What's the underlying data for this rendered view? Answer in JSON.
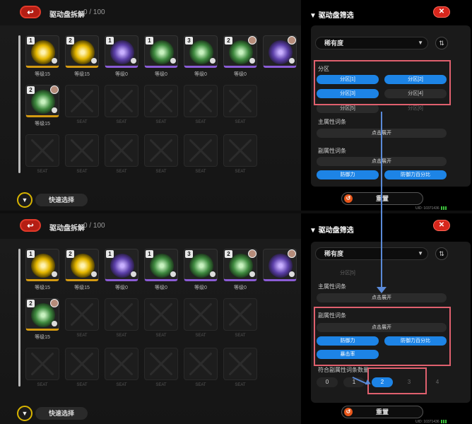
{
  "inventory": {
    "back_label": "↩",
    "title": "驱动盘拆解",
    "count": "0 / 100",
    "quick_select": "快速选择",
    "items": [
      {
        "rank": "1",
        "level": "等级15",
        "disc": "yellow",
        "accent": "gold",
        "avatar": false
      },
      {
        "rank": "2",
        "level": "等级15",
        "disc": "yellow",
        "accent": "gold",
        "avatar": false
      },
      {
        "rank": "1",
        "level": "等级0",
        "disc": "violet",
        "accent": "purple",
        "avatar": false
      },
      {
        "rank": "1",
        "level": "等级0",
        "disc": "green",
        "accent": "purple",
        "avatar": false
      },
      {
        "rank": "3",
        "level": "等级0",
        "disc": "green",
        "accent": "purple",
        "avatar": false
      },
      {
        "rank": "2",
        "level": "等级0",
        "disc": "green",
        "accent": "purple",
        "avatar": true
      },
      {
        "rank": "",
        "level": "",
        "disc": "violet",
        "accent": "purple",
        "avatar": true
      },
      {
        "rank": "2",
        "level": "等级15",
        "disc": "green",
        "accent": "gold",
        "avatar": true
      }
    ],
    "empty_label": "SEAT"
  },
  "filter": {
    "title": "驱动盘筛选",
    "close_label": "✕",
    "sort_select": "稀有度",
    "partition_label": "分区",
    "partitions": [
      "分区[1]",
      "分区[2]",
      "分区[3]",
      "分区[4]",
      "分区[5]",
      "分区[6]"
    ],
    "main_stat_label": "主属性词条",
    "expand_label": "点击展开",
    "sub_stat_label": "副属性词条",
    "sub_stats": [
      "防御力",
      "防御力百分比",
      "暴击率"
    ],
    "match_count_label": "符合副属性词条数量",
    "match_counts": [
      "0",
      "1",
      "2",
      "3",
      "4"
    ],
    "reset_label": "重置",
    "uid": "UID: 10371436"
  },
  "colors": {
    "accent_blue": "#1d84e6",
    "highlight": "#e0606e",
    "close_red": "#d7261c",
    "arrow": "#5a8ad8"
  }
}
